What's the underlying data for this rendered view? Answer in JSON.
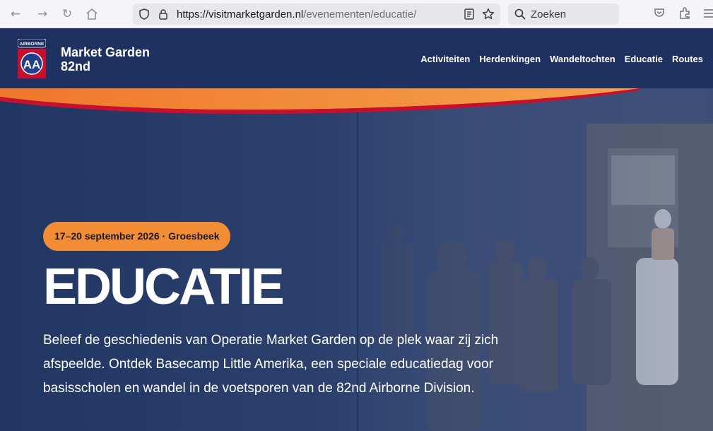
{
  "browser": {
    "url_base": "https://visitmarketgarden.nl",
    "url_path": "/evenementen/educatie/",
    "search_placeholder": "Zoeken"
  },
  "site": {
    "logo_label": "AIRBORNE",
    "logo_monogram": "AA",
    "brand_line1": "Market Garden",
    "brand_line2": "82nd",
    "nav": [
      {
        "label": "Activiteiten"
      },
      {
        "label": "Herdenkingen"
      },
      {
        "label": "Wandeltochten"
      },
      {
        "label": "Educatie"
      },
      {
        "label": "Routes"
      }
    ]
  },
  "hero": {
    "badge": "17–20 september 2026 · Groesbeek",
    "title": "EDUCATIE",
    "description": "Beleef de geschiedenis van Operatie Market Garden op de plek waar zij zich afspeelde. Ontdek Basecamp Little Amerika, een speciale educatiedag voor basisscholen en wandel in de voetsporen van de 82nd Airborne Division."
  },
  "colors": {
    "header_bg": "#1f3160",
    "accent_orange": "#f28c35",
    "accent_red": "#c8102e"
  }
}
